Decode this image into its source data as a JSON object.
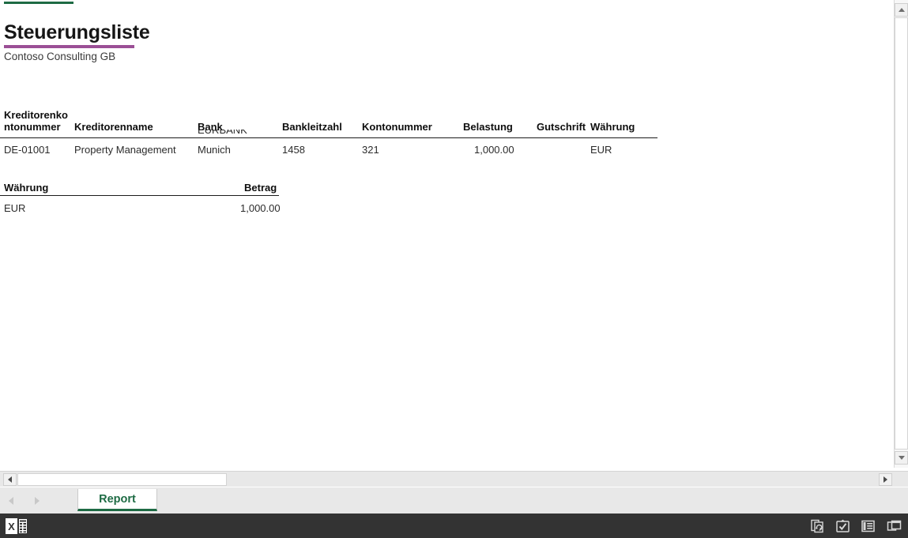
{
  "report": {
    "title": "Steuerungsliste",
    "subtitle": "Contoso Consulting GB",
    "accent_color": "#1E6B44",
    "title_rule_color": "#9B4F96"
  },
  "detail_table": {
    "headers": [
      "Kreditorenko\nntonummer",
      "Kreditorenname",
      "Bank",
      "Bankleitzahl",
      "Kontonummer",
      "Belastung",
      "Gutschrift",
      "Währung"
    ],
    "clipped_overflow_text": "EURBANK",
    "rows": [
      {
        "kreditorenkontonummer": "DE-01001",
        "kreditorenname": "Property Management",
        "bank": "Munich",
        "bankleitzahl": "1458",
        "kontonummer": "321",
        "belastung": "1,000.00",
        "gutschrift": "",
        "waehrung": "EUR"
      }
    ]
  },
  "summary_table": {
    "headers": [
      "Währung",
      "Betrag"
    ],
    "rows": [
      {
        "waehrung": "EUR",
        "betrag": "1,000.00"
      }
    ]
  },
  "sheet_tabs": {
    "active_tab": "Report",
    "tab_color": "#1E6B44"
  },
  "status_bar": {
    "app_icon": "excel-logo",
    "icons": [
      "refresh-pages-icon",
      "clipboard-check-icon",
      "reading-view-icon",
      "window-restore-icon"
    ]
  }
}
